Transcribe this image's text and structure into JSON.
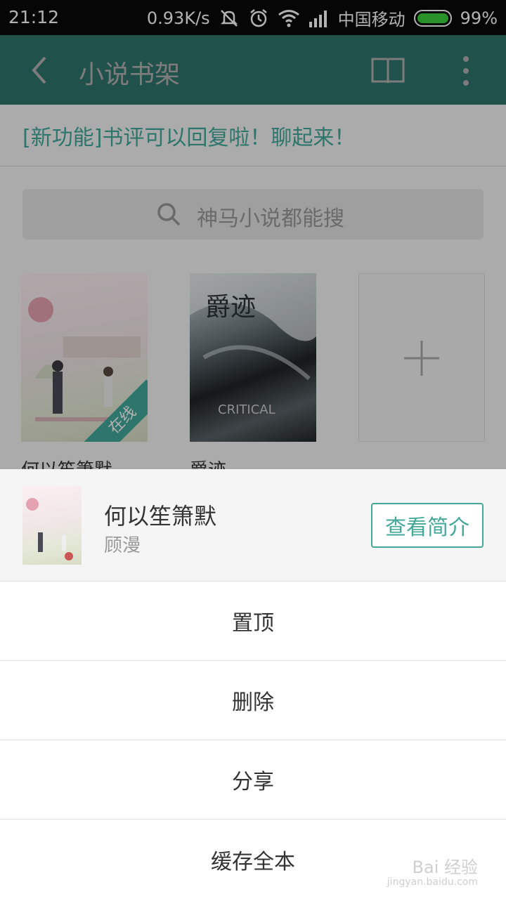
{
  "status_bar": {
    "time": "21:12",
    "net_speed": "0.93K/s",
    "carrier": "中国移动",
    "battery": "99%"
  },
  "app_bar": {
    "title": "小说书架",
    "icons": [
      "back-arrow-icon",
      "book-icon",
      "more-vert-icon"
    ]
  },
  "notice": "[新功能]书评可以回复啦！聊起来！",
  "search": {
    "placeholder": "神马小说都能搜"
  },
  "shelf": {
    "books": [
      {
        "title": "何以笙箫默",
        "badge": "在线"
      },
      {
        "title": "爵迹"
      }
    ],
    "add_icon": "plus-icon"
  },
  "sheet": {
    "book_title": "何以笙箫默",
    "author": "顾漫",
    "intro_button": "查看简介",
    "menu": [
      "置顶",
      "删除",
      "分享",
      "缓存全本"
    ]
  },
  "watermark": {
    "text": "Bai 经验",
    "url": "jingyan.baidu.com"
  },
  "colors": {
    "accent": "#43a89a",
    "status_bar": "#0a0a0a"
  }
}
